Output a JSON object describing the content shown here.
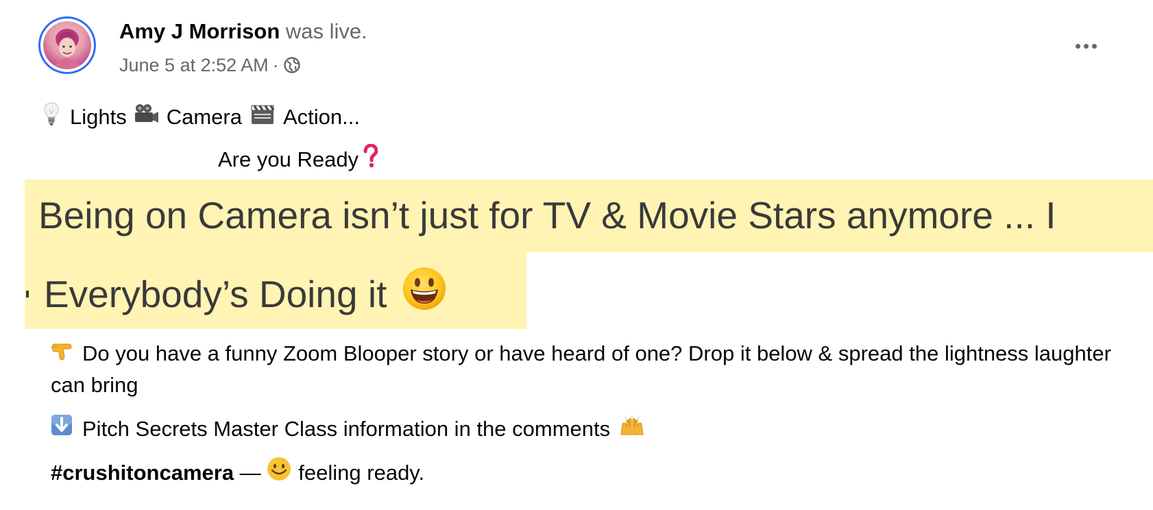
{
  "header": {
    "author_name": "Amy J Morrison",
    "live_text": " was live.",
    "timestamp": "June 5 at 2:52 AM",
    "separator": "·",
    "privacy_icon": "globe-icon",
    "more_icon": "more-options-icon"
  },
  "post": {
    "line1": {
      "lights": "Lights",
      "camera": "Camera",
      "action": "Action...",
      "icons": [
        "light-bulb-icon",
        "movie-camera-icon",
        "clapper-board-icon"
      ]
    },
    "line2": {
      "text": "Are you Ready",
      "icon": "question-mark-icon"
    },
    "banner1": "Being on Camera isn’t just for TV & Movie Stars anymore ... I",
    "banner2": "Everybody’s Doing it",
    "paragraph1": "Do you have a funny Zoom Blooper story or have heard of one? Drop it below & spread the lightness laughter can bring",
    "paragraph2": "Pitch Secrets Master Class information in the comments",
    "hashtag": "#crushitoncamera",
    "feeling_dash": " — ",
    "feeling_text": "feeling ready."
  },
  "colors": {
    "avatar_ring": "#2d6ef6",
    "highlight": "#fff4b3",
    "secondary_text": "#65676b",
    "question_mark": "#e0245e"
  }
}
